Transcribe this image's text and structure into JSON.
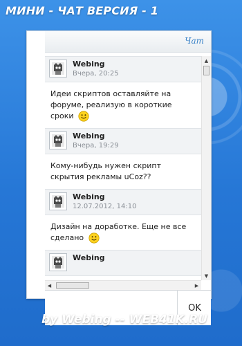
{
  "title": "МИНИ - ЧАТ ВЕРСИЯ - 1",
  "header": {
    "link_label": "Чат"
  },
  "messages": [
    {
      "author": "Webing",
      "time": "Вчера, 20:25",
      "text": "Идеи скриптов оставляйте на форуме, реализую в короткие сроки",
      "smile": true
    },
    {
      "author": "Webing",
      "time": "Вчера, 19:29",
      "text": "Кому-нибудь нужен скрипт скрытия рекламы uCoz??",
      "smile": false
    },
    {
      "author": "Webing",
      "time": "12.07.2012, 14:10",
      "text": "Дизайн на доработке. Еще не все сделано",
      "smile": true
    },
    {
      "author": "Webing",
      "time": "",
      "text": "",
      "smile": false
    }
  ],
  "input": {
    "value": "",
    "submit_label": "OK"
  },
  "footer": "by Webing  -- WEB41K.RU",
  "colors": {
    "background": "#2a7cd8",
    "link": "#3b83c8",
    "header_bg": "#f1f3f5"
  }
}
